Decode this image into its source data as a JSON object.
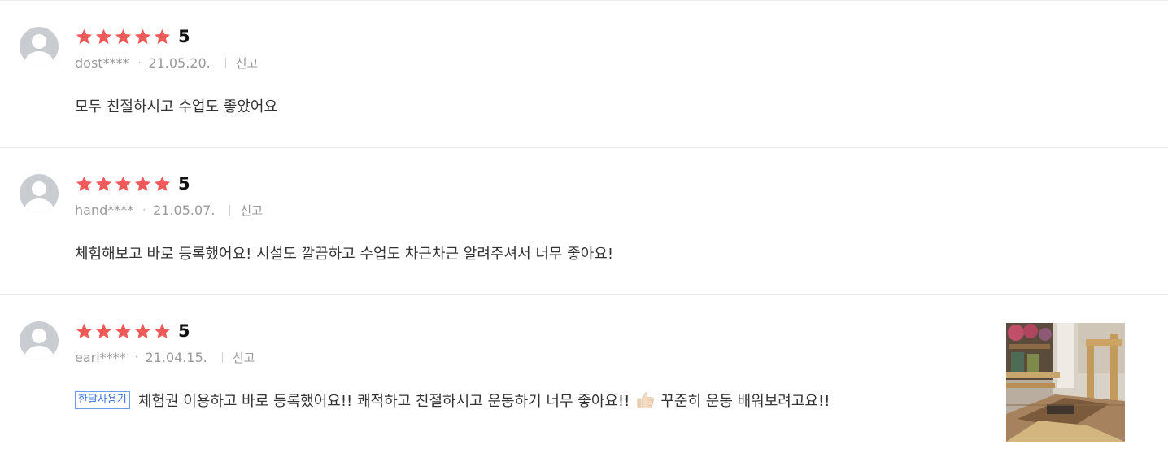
{
  "colors": {
    "star": "#f05a5a",
    "tag_border": "#6f9bea",
    "tag_text": "#3a73d9",
    "meta_text": "#9a9a9a",
    "avatar_bg": "#c9ccd1"
  },
  "reviews": [
    {
      "rating_stars": 5,
      "score": "5",
      "user": "dost****",
      "date": "21.05.20.",
      "report_label": "신고",
      "text": "모두 친절하시고 수업도 좋았어요"
    },
    {
      "rating_stars": 5,
      "score": "5",
      "user": "hand****",
      "date": "21.05.07.",
      "report_label": "신고",
      "text": "체험해보고 바로 등록했어요! 시설도 깔끔하고 수업도 차근차근 알려주셔서 너무 좋아요!"
    },
    {
      "rating_stars": 5,
      "score": "5",
      "user": "earl****",
      "date": "21.04.15.",
      "report_label": "신고",
      "tag": "한달사용기",
      "text_before_icon": "체험권 이용하고 바로 등록했어요!! 쾌적하고 친절하시고 운동하기 너무 좋아요!!",
      "icon": "thumbs-up-icon",
      "text_after_icon": "꾸준히 운동 배워보려고요!!",
      "photo": "pilates-studio-photo"
    }
  ]
}
